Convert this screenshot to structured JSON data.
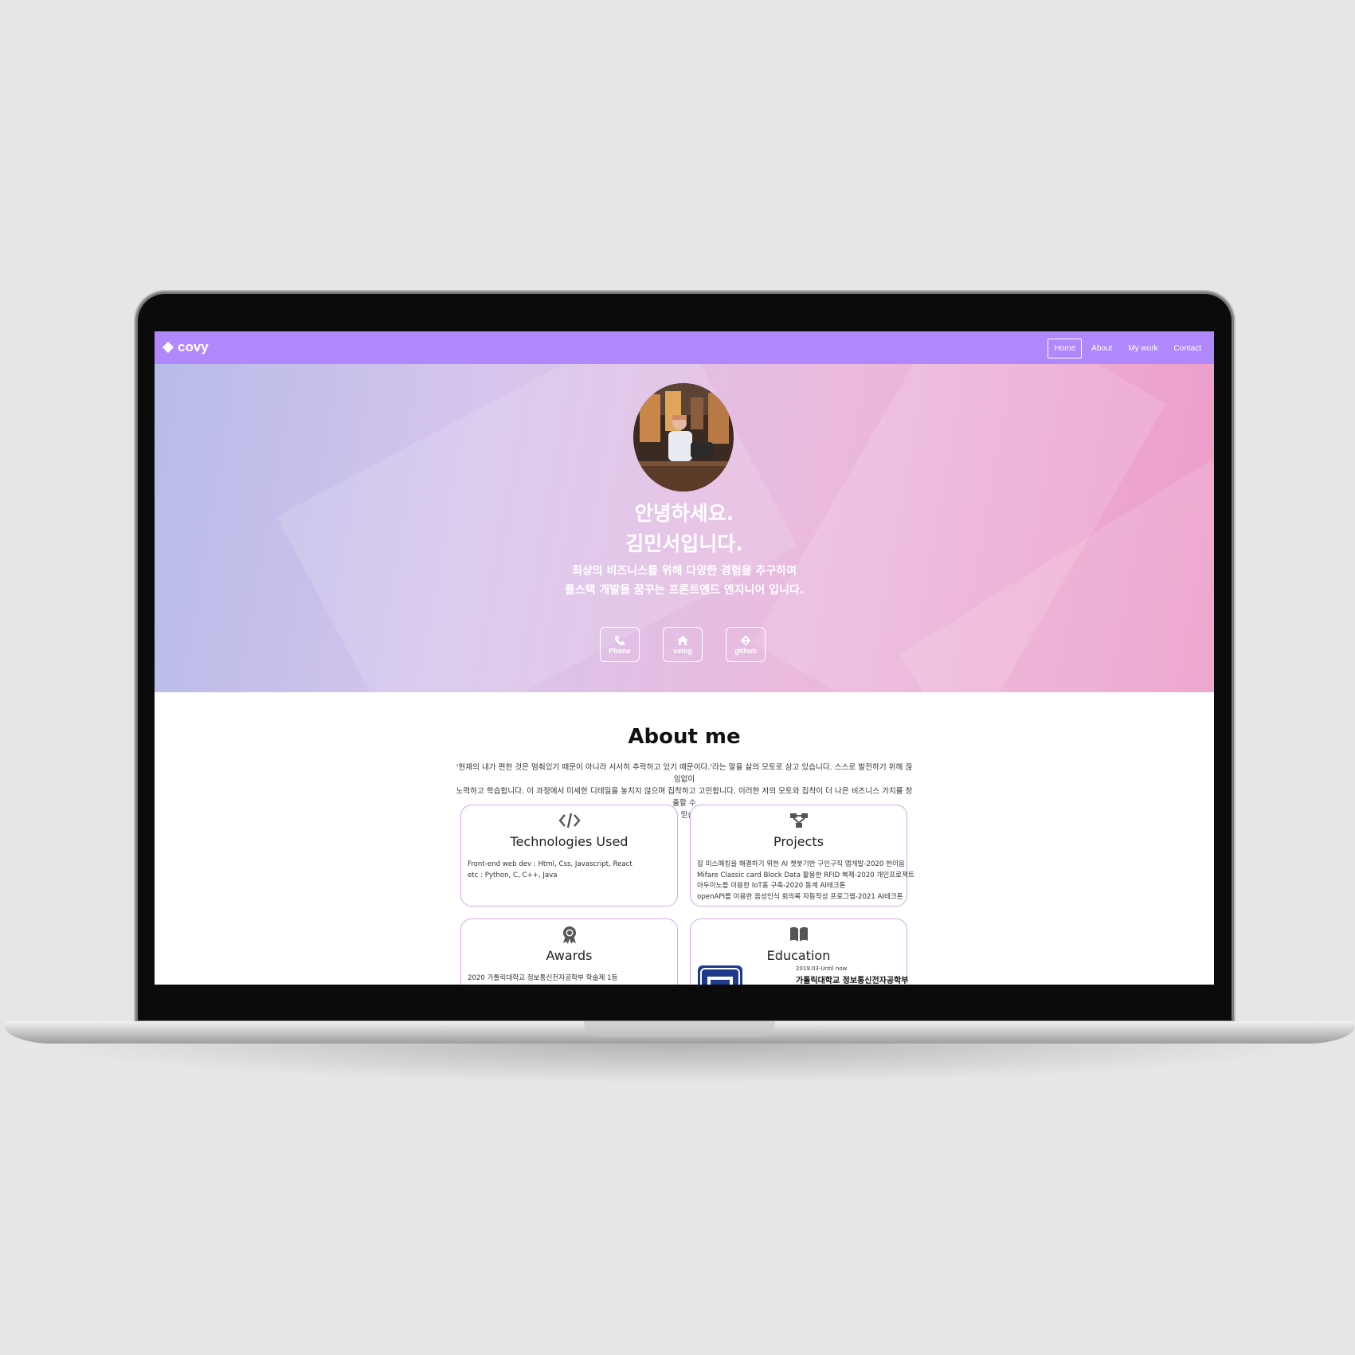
{
  "navbar": {
    "brand": "covy",
    "items": [
      {
        "label": "Home"
      },
      {
        "label": "About"
      },
      {
        "label": "My work"
      },
      {
        "label": "Contact"
      }
    ]
  },
  "hero": {
    "title_line1": "안녕하세요.",
    "title_line2": "김민서입니다.",
    "subtitle_line1": "최상의 비즈니스를 위해 다양한 경험을 추구하며",
    "subtitle_line2": "풀스택 개발을 꿈꾸는 프론트엔드 엔지니어 입니다.",
    "buttons": [
      {
        "label": "Phone",
        "icon": "phone-icon"
      },
      {
        "label": "velog",
        "icon": "home-icon"
      },
      {
        "label": "github",
        "icon": "git-icon"
      }
    ]
  },
  "about": {
    "title": "About me",
    "desc_line1": "'현재의 내가 편한 것은 멈춰있기 때문이 아니라 서서히 추락하고 있기 때문이다.'라는 말을 삶의 모토로 삼고 있습니다. 스스로 발전하기 위해 끊임없이",
    "desc_line2": "노력하고 학습합니다. 이 과정에서 미세한 디테일을 놓치지 않으며 집착하고 고민합니다. 이러한 저의 모토와 집착이 더 나은 비즈니스 가치를 창출할 수",
    "desc_line3": "있다고 믿습니다.",
    "cards": {
      "tech": {
        "title": "Technologies Used",
        "icon": "code-icon",
        "lines": [
          "Front-end web dev : Html, Css, Javascript, React",
          "etc : Python, C, C++, Java"
        ]
      },
      "projects": {
        "title": "Projects",
        "icon": "sitemap-icon",
        "lines": [
          "잡 미스매칭을 해결하기 위한 AI 챗봇기반 구인구직 앱개발-2020 한이음",
          "Mifare Classic card Block Data 활용한 RFID 복제-2020 개인프로젝트",
          "아두이노를 이용한 IoT홈 구축-2020 동계 AI테크톤",
          "openAPI를 이용한 음성인식 회의록 자동작성 프로그램-2021 AI테크톤"
        ]
      },
      "awards": {
        "title": "Awards",
        "icon": "award-icon",
        "lines": [
          "2020 가톨릭대학교 정보통신전자공학부 학술제 1등"
        ]
      },
      "education": {
        "title": "Education",
        "icon": "book-icon",
        "date": "2019.03-Until now",
        "school": "가톨릭대학교 정보통신전자공학부"
      }
    }
  },
  "colors": {
    "navbar": "#b188fc",
    "card_border": "#d5a8ef",
    "background": "#e6e6e6"
  }
}
